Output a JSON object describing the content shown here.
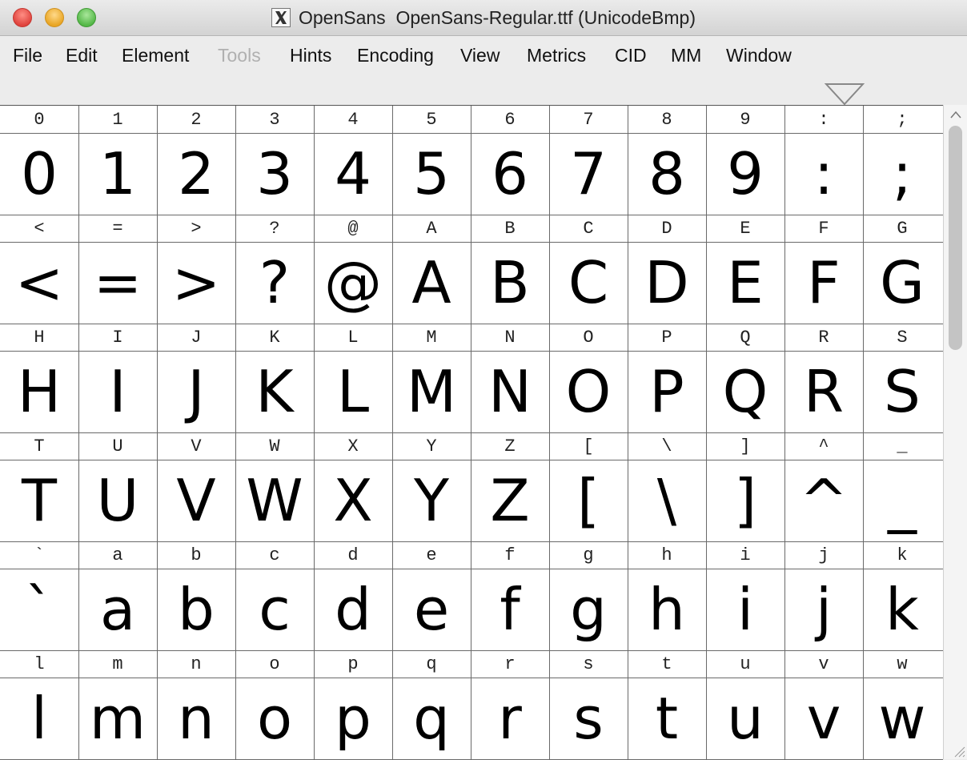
{
  "window": {
    "title": "OpenSans  OpenSans-Regular.ttf (UnicodeBmp)"
  },
  "menubar": {
    "items": [
      {
        "label": "File",
        "disabled": false
      },
      {
        "label": "Edit",
        "disabled": false
      },
      {
        "label": "Element",
        "disabled": false
      },
      {
        "label": "Tools",
        "disabled": true
      },
      {
        "label": "Hints",
        "disabled": false
      },
      {
        "label": "Encoding",
        "disabled": false
      },
      {
        "label": "View",
        "disabled": false
      },
      {
        "label": "Metrics",
        "disabled": false
      },
      {
        "label": "CID",
        "disabled": false
      },
      {
        "label": "MM",
        "disabled": false
      },
      {
        "label": "Window",
        "disabled": false
      }
    ],
    "overflow_icon": "triangle-down-icon"
  },
  "glyph_grid": {
    "rows": [
      [
        "0",
        "1",
        "2",
        "3",
        "4",
        "5",
        "6",
        "7",
        "8",
        "9",
        ":",
        ";"
      ],
      [
        "<",
        "=",
        ">",
        "?",
        "@",
        "A",
        "B",
        "C",
        "D",
        "E",
        "F",
        "G"
      ],
      [
        "H",
        "I",
        "J",
        "K",
        "L",
        "M",
        "N",
        "O",
        "P",
        "Q",
        "R",
        "S"
      ],
      [
        "T",
        "U",
        "V",
        "W",
        "X",
        "Y",
        "Z",
        "[",
        "\\",
        "]",
        "^",
        "_"
      ],
      [
        "`",
        "a",
        "b",
        "c",
        "d",
        "e",
        "f",
        "g",
        "h",
        "i",
        "j",
        "k"
      ],
      [
        "l",
        "m",
        "n",
        "o",
        "p",
        "q",
        "r",
        "s",
        "t",
        "u",
        "v",
        "w"
      ]
    ]
  },
  "colors": {
    "close": "#e0443e",
    "minimize": "#e9a625",
    "maximize": "#55b848"
  }
}
